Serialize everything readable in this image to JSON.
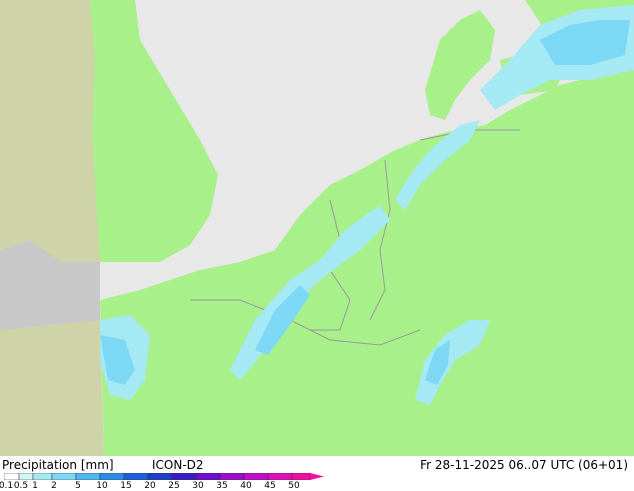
{
  "legend": {
    "title": "Precipitation [mm]",
    "model": "ICON-D2",
    "valid_time": "Fr 28-11-2025 06..07 UTC (06+01)",
    "scale_labels": [
      "0.1",
      "0.5",
      "1",
      "2",
      "5",
      "10",
      "15",
      "20",
      "25",
      "30",
      "35",
      "40",
      "45",
      "50"
    ],
    "scale_colors": [
      "#ffffff",
      "#cff5f5",
      "#a5e9f5",
      "#7dd8f5",
      "#4fb8f0",
      "#2a8ce6",
      "#1f5fdb",
      "#1f3fc8",
      "#3a1fc0",
      "#6a10c8",
      "#9a10c8",
      "#c010c8",
      "#e010b8",
      "#f010a0"
    ]
  },
  "map": {
    "colors": {
      "sea": "#e8e8e8",
      "land_domain": "#a8f08a",
      "land_outside": "#cfd3a8",
      "outside_sea": "#c8c8c8",
      "border": "#9a9a9a",
      "precip_light": "#a5e9f5",
      "precip_mid": "#7dd8f5",
      "precip_strong": "#4fb8f0"
    }
  }
}
